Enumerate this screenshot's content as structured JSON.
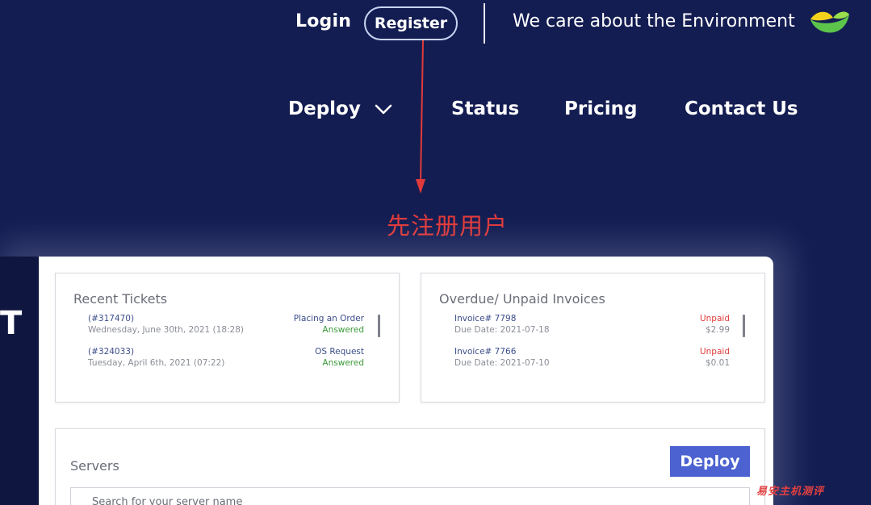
{
  "topbar": {
    "login_label": "Login",
    "register_label": "Register",
    "tagline": "We care about the Environment"
  },
  "nav": {
    "deploy_label": "Deploy",
    "status_label": "Status",
    "pricing_label": "Pricing",
    "contact_label": "Contact Us"
  },
  "annotation": {
    "text": "先注册用户",
    "color": "#e13a3a"
  },
  "dashboard": {
    "edge_letter": "T",
    "tickets": {
      "title": "Recent Tickets",
      "rows": [
        {
          "id": "(#317470)",
          "date": "Wednesday, June 30th, 2021 (18:28)",
          "subject": "Placing an Order",
          "status": "Answered"
        },
        {
          "id": "(#324033)",
          "date": "Tuesday, April 6th, 2021 (07:22)",
          "subject": "OS Request",
          "status": "Answered"
        }
      ]
    },
    "invoices": {
      "title": "Overdue/ Unpaid Invoices",
      "rows": [
        {
          "number": "Invoice# 7798",
          "due": "Due Date: 2021-07-18",
          "status": "Unpaid",
          "amount": "$2.99"
        },
        {
          "number": "Invoice# 7766",
          "due": "Due Date: 2021-07-10",
          "status": "Unpaid",
          "amount": "$0.01"
        }
      ]
    },
    "servers": {
      "title": "Servers",
      "deploy_button": "Deploy",
      "search_placeholder": "Search for your server name"
    }
  },
  "watermark": "易安主机测评",
  "colors": {
    "background": "#141d52",
    "accent": "#4b62d0",
    "answered": "#3b9a3b",
    "unpaid": "#e03b3b"
  }
}
